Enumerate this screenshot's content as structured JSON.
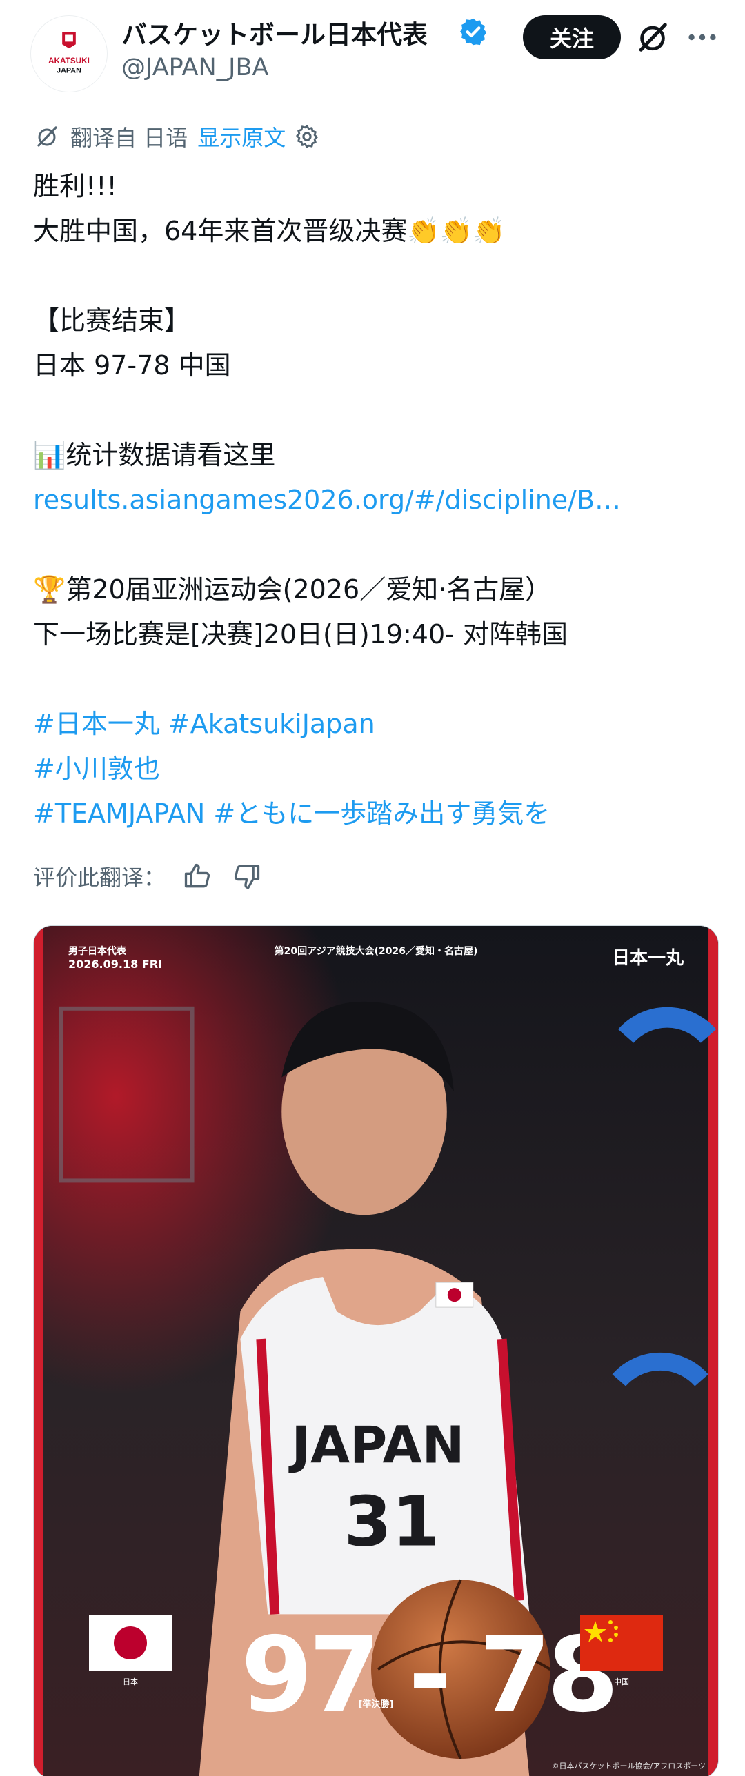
{
  "header": {
    "avatar_text": [
      "AKATSUKI",
      "JAPAN"
    ],
    "display_name": "バスケットボール日本代表",
    "handle": "@JAPAN_JBA",
    "follow_label": "关注",
    "more_label": "···"
  },
  "translation": {
    "note": "翻译自 日语",
    "show_original": "显示原文"
  },
  "post": {
    "lines": [
      "胜利!!!",
      "大胜中国，64年来首次晋级决赛👏👏👏",
      "",
      "【比赛结束】",
      "日本 97-78 中国",
      "",
      "📊统计数据请看这里",
      "results.asiangames2026.org/#/discipline/B…",
      "",
      "🏆第20届亚洲运动会(2026／爱知·名古屋）",
      "下一场比赛是[决赛]20日(日)19:40- 对阵韩国",
      "",
      "#日本一丸 #AkatsukiJapan",
      "#小川敦也",
      "#TEAMJAPAN #ともに一歩踏み出す勇気を"
    ],
    "link_line_indices": [
      7,
      12,
      13,
      14
    ]
  },
  "rate": {
    "label": "评价此翻译："
  },
  "media": {
    "team_label": "男子日本代表",
    "date": "2026.09.18 FRI",
    "event": "第20回アジア競技大会(2026／愛知・名古屋)",
    "brand": "日本一丸",
    "jersey_text": "JAPAN",
    "jersey_number": "31",
    "score": "97 - 78",
    "stage": "[準決勝]",
    "left_team": "日本",
    "right_team": "中国",
    "copyright": "©日本バスケットボール協会/アフロスポーツ"
  },
  "icons": {
    "verified": "verified-badge-icon",
    "grok": "grok-icon",
    "translate": "translate-icon",
    "settings": "gear-icon",
    "thumb_up": "thumbs-up-icon",
    "thumb_down": "thumbs-down-icon"
  },
  "colors": {
    "link": "#1d9bf0",
    "verified": "#1d9bf0",
    "text": "#0f1419",
    "secondary": "#536471",
    "follow_bg": "#0f1419"
  }
}
